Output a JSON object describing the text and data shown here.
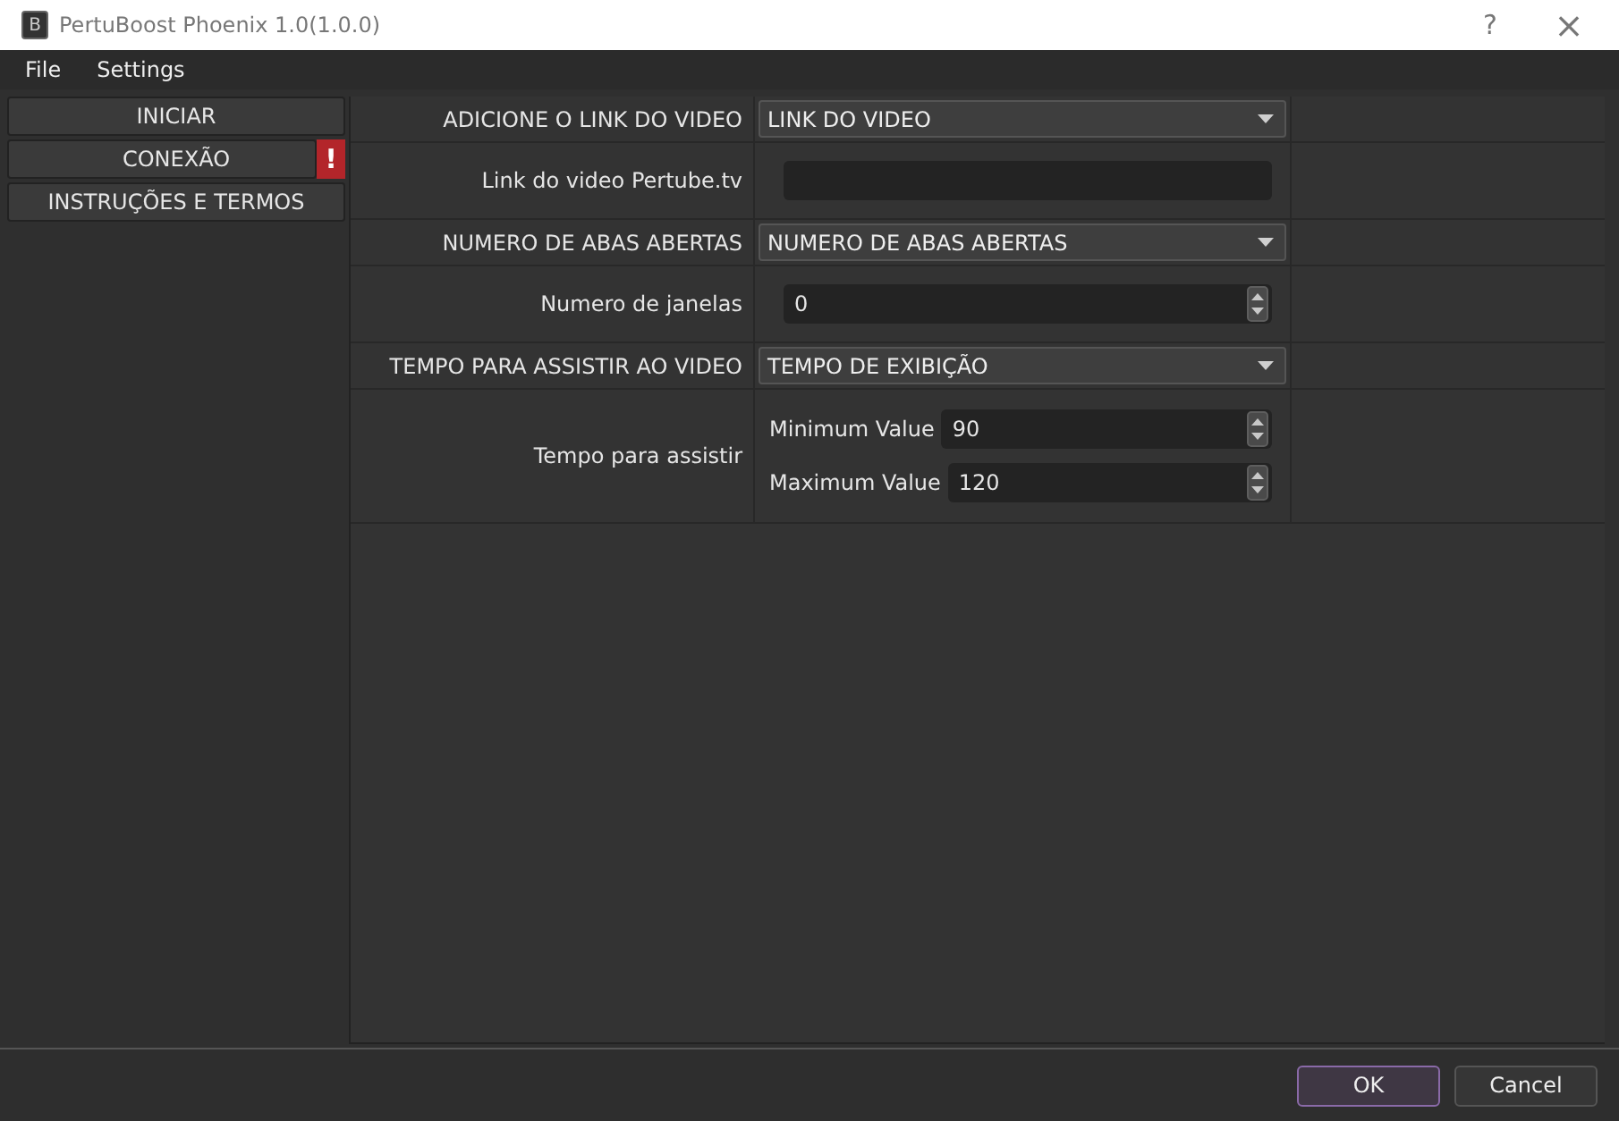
{
  "window": {
    "title": "PertuBoost Phoenix 1.0(1.0.0)",
    "app_icon": "B",
    "help": "?",
    "close": "×"
  },
  "menu": [
    "File",
    "Settings"
  ],
  "sidebar": {
    "items": [
      {
        "label": "INICIAR"
      },
      {
        "label": "CONEXÃO",
        "badge": "!"
      },
      {
        "label": "INSTRUÇÕES E TERMOS"
      }
    ]
  },
  "form": [
    {
      "kind": "combo",
      "label": "ADICIONE O LINK DO VIDEO",
      "value": "LINK DO VIDEO"
    },
    {
      "kind": "text",
      "label": "Link do video Pertube.tv"
    },
    {
      "kind": "combo",
      "label": "NUMERO DE ABAS ABERTAS",
      "value": "NUMERO DE ABAS ABERTAS"
    },
    {
      "kind": "spin",
      "label": "Numero de janelas",
      "value": "0"
    },
    {
      "kind": "combo",
      "label": "TEMPO PARA ASSISTIR AO VIDEO",
      "value": "TEMPO DE EXIBIÇÃO"
    },
    {
      "kind": "range",
      "label": "Tempo para assistir",
      "fields": [
        {
          "label": "Minimum Value",
          "value": "90"
        },
        {
          "label": "Maximum Value",
          "value": "120"
        }
      ]
    }
  ],
  "buttons": [
    {
      "label": "OK",
      "default": true
    },
    {
      "label": "Cancel",
      "default": false
    }
  ]
}
